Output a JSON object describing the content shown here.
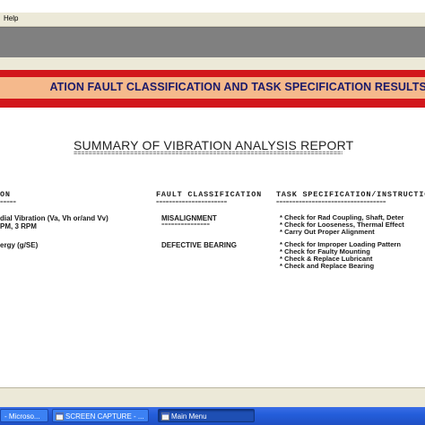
{
  "menu": {
    "help_label": "Help"
  },
  "banner": {
    "title": "ATION FAULT CLASSIFICATION AND TASK SPECIFICATION RESULTS"
  },
  "report": {
    "summary_title": "SUMMARY OF VIBRATION ANALYSIS REPORT",
    "separator": "==========================================================================",
    "columns": [
      {
        "label": "ON",
        "underline": "======"
      },
      {
        "label": "FAULT CLASSIFICATION",
        "underline": "======================"
      },
      {
        "label": "TASK SPECIFICATION/INSTRUCTION",
        "underline": "=================================="
      }
    ],
    "rows": [
      {
        "symptom_lines": [
          "dial Vibration (Va, Vh or/and Vv)",
          "PM, 3 RPM"
        ],
        "fault": "MISALIGNMENT",
        "fault_underline": "===============",
        "tasks": [
          "* Check for Rad Coupling, Shaft, Deter",
          "* Check for Looseness, Thermal Effect",
          "* Carry Out Proper Alignment"
        ]
      },
      {
        "symptom_lines": [
          "ergy (g/SE)"
        ],
        "fault": "DEFECTIVE BEARING",
        "fault_underline": "",
        "tasks": [
          "* Check for Improper Loading Pattern",
          "* Check for Faulty Mounting",
          "* Check & Replace Lubricant",
          "* Check and Replace Bearing"
        ]
      }
    ]
  },
  "taskbar": {
    "items": [
      {
        "label": "- Microso..."
      },
      {
        "label": "SCREEN CAPTURE - ..."
      },
      {
        "label": "Main Menu"
      }
    ]
  },
  "colors": {
    "title_band": "#d2161b",
    "title_box": "#f5b98c",
    "title_text": "#1a1a6a",
    "taskbar": "#245edb"
  }
}
